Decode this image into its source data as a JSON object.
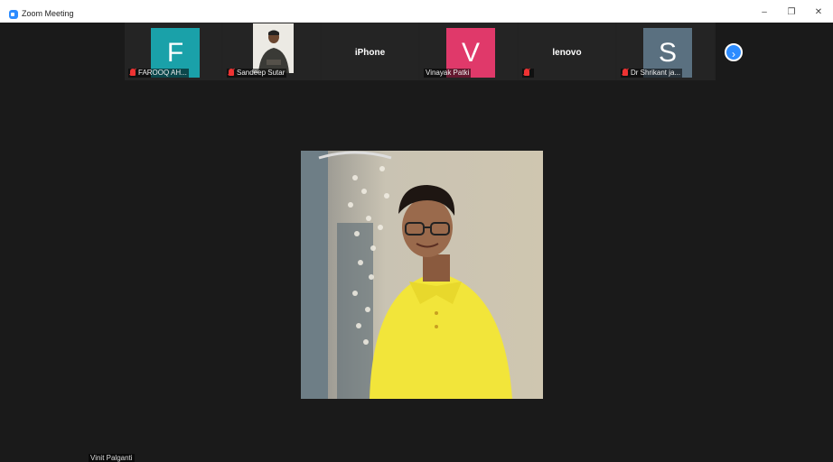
{
  "window": {
    "title": "Zoom Meeting",
    "minimize_glyph": "–",
    "restore_glyph": "❐",
    "close_glyph": "✕"
  },
  "participants": [
    {
      "name": "FAROOQ AH...",
      "avatar": "F",
      "avatar_color": "#1aa1a9",
      "muted": true
    },
    {
      "name": "Sandeep Sutar",
      "avatar": "",
      "muted": true
    },
    {
      "name": "iPhone",
      "avatar": ""
    },
    {
      "name": "Vinayak Patki",
      "avatar": "V",
      "avatar_color": "#e0396a",
      "muted": false
    },
    {
      "name": "lenovo",
      "avatar": "",
      "muted": true
    },
    {
      "name": "Dr Shrikant ja...",
      "avatar": "S",
      "avatar_color": "#5a7080",
      "muted": true
    }
  ],
  "next_page_glyph": "›",
  "active_speaker": {
    "name": "Vinit Palganti"
  },
  "colors": {
    "background": "#1a1a1a",
    "accent": "#2d8cff",
    "muted": "#e33333"
  }
}
